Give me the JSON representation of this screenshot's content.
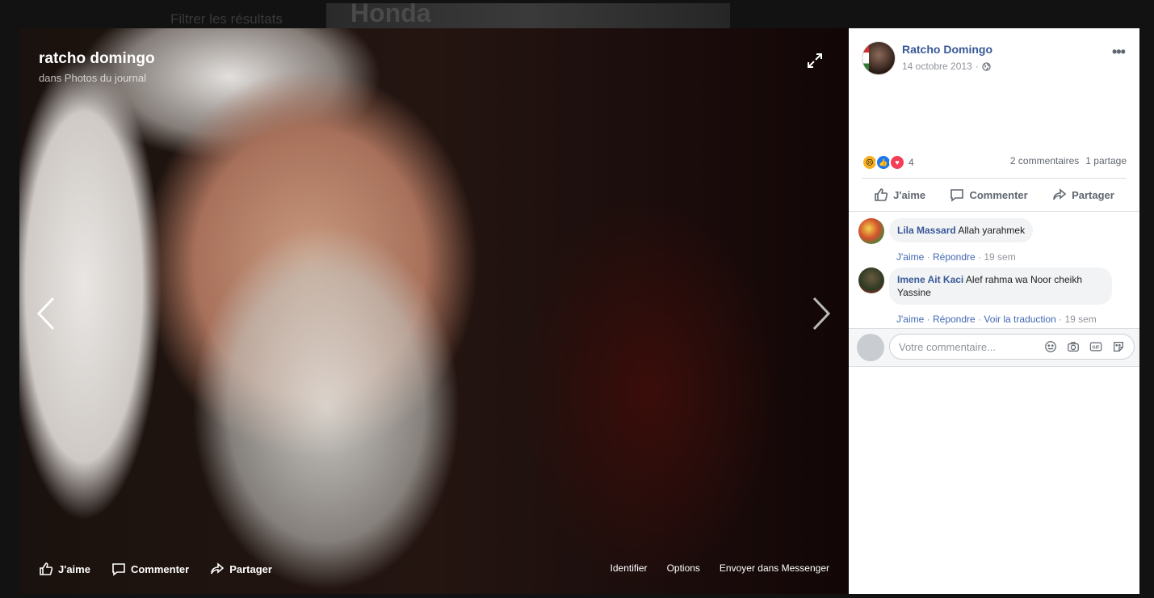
{
  "background": {
    "filter_label": "Filtrer les résultats",
    "ad_text": "Honda"
  },
  "viewer": {
    "title": "ratcho domingo",
    "subtitle": "dans Photos du journal",
    "actions": {
      "like": "J'aime",
      "comment": "Commenter",
      "share": "Partager"
    },
    "right_links": {
      "tag": "Identifier",
      "options": "Options",
      "send": "Envoyer dans Messenger"
    }
  },
  "post": {
    "author": "Ratcho Domingo",
    "date": "14 octobre 2013",
    "reaction_count": "4",
    "comments_count": "2 commentaires",
    "shares_count": "1 partage",
    "actions": {
      "like": "J'aime",
      "comment": "Commenter",
      "share": "Partager"
    }
  },
  "comments": [
    {
      "name": "Lila Massard",
      "text": "Allah yarahmek",
      "like": "J'aime",
      "reply": "Répondre",
      "time": "19 sem"
    },
    {
      "name": "Imene Ait Kaci",
      "text": "Alef rahma wa Noor cheikh Yassine",
      "like": "J'aime",
      "reply": "Répondre",
      "translate": "Voir la traduction",
      "time": "19 sem"
    }
  ],
  "composer": {
    "placeholder": "Votre commentaire...",
    "gif": "GIF"
  },
  "colors": {
    "link_blue": "#385898",
    "meta_grey": "#90949c",
    "action_grey": "#606770"
  }
}
